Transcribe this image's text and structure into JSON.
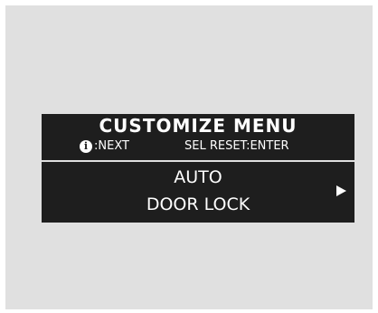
{
  "menu": {
    "title": "CUSTOMIZE MENU",
    "hint_icon": "info-icon",
    "hint_icon_glyph": "i",
    "hint_left": ":NEXT",
    "hint_right": "SEL RESET:ENTER",
    "item": {
      "line1": "AUTO",
      "line2": "DOOR LOCK"
    },
    "arrow_icon": "right-triangle-icon"
  },
  "colors": {
    "display_bg": "#1e1e1e",
    "panel_bg": "#e0e0e0",
    "text": "#ffffff"
  }
}
